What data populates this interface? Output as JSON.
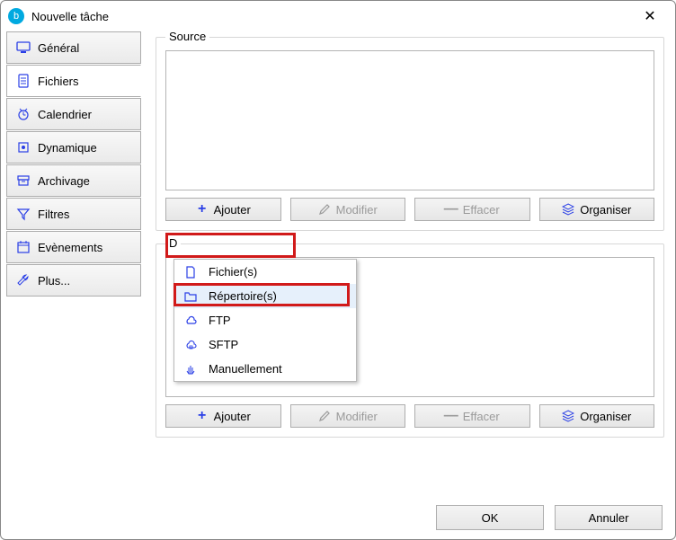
{
  "window": {
    "title": "Nouvelle tâche"
  },
  "sidebar": {
    "items": [
      {
        "label": "Général"
      },
      {
        "label": "Fichiers"
      },
      {
        "label": "Calendrier"
      },
      {
        "label": "Dynamique"
      },
      {
        "label": "Archivage"
      },
      {
        "label": "Filtres"
      },
      {
        "label": "Evènements"
      },
      {
        "label": "Plus..."
      }
    ]
  },
  "groups": {
    "source": {
      "label": "Source"
    },
    "dest": {
      "label": "D"
    }
  },
  "toolbar": {
    "add": "Ajouter",
    "edit": "Modifier",
    "erase": "Effacer",
    "organise": "Organiser"
  },
  "menu": {
    "items": [
      {
        "label": "Fichier(s)"
      },
      {
        "label": "Répertoire(s)"
      },
      {
        "label": "FTP"
      },
      {
        "label": "SFTP"
      },
      {
        "label": "Manuellement"
      }
    ]
  },
  "footer": {
    "ok": "OK",
    "cancel": "Annuler"
  }
}
